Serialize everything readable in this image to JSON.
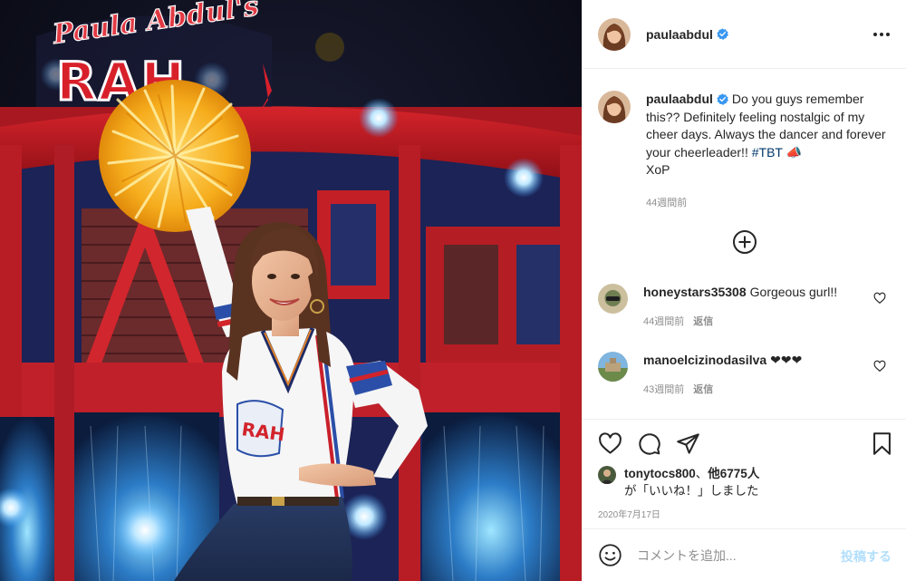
{
  "post": {
    "username": "paulaabdul",
    "verified": true,
    "more_icon": "more-horizontal-icon",
    "image": {
      "sign_text": "Paula Abdul's RAH!",
      "sign_script": "Paula Abdul's",
      "sign_big": "RAH",
      "shirt_text": "RAH"
    }
  },
  "caption": {
    "username": "paulaabdul",
    "text": "Do you guys remember this?? Definitely feeling nostalgic of my cheer days. Always the dancer and forever your cheerleader!!",
    "hashtag": "#TBT",
    "sign_off": "XoP",
    "emoji": "📣",
    "time": "44週間前"
  },
  "load_more_icon": "plus-circle-icon",
  "comments": [
    {
      "username": "honeystars35308",
      "text": "Gorgeous gurl!!",
      "time": "44週間前",
      "reply_label": "返信"
    },
    {
      "username": "manoelcizinodasilva",
      "text": "❤❤❤",
      "time": "43週間前",
      "reply_label": "返信"
    }
  ],
  "actions": {
    "like_icon": "heart-icon",
    "comment_icon": "comment-icon",
    "share_icon": "share-icon",
    "save_icon": "bookmark-icon"
  },
  "likes": {
    "first_user": "tonytocs800",
    "separator": "、",
    "others": "他6775人",
    "suffix": "が「いいね！」しました"
  },
  "date": "2020年7月17日",
  "add_comment": {
    "placeholder": "コメントを追加...",
    "post_label": "投稿する",
    "emoji_icon": "smiley-icon"
  },
  "colors": {
    "verified_blue": "#3897f0",
    "hashtag": "#00376b",
    "meta_gray": "#8e8e8e",
    "post_button": "#b2dffc",
    "border": "#efefef"
  }
}
